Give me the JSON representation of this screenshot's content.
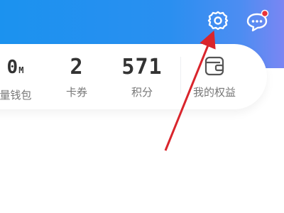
{
  "header": {
    "settings_icon": "gear-icon",
    "message_icon": "chat-bubble-icon",
    "background_color": "#1b92ef",
    "notification_dot_color": "#e8333a"
  },
  "stats": {
    "wallet": {
      "value": "0",
      "unit": "M",
      "label": "量钱包"
    },
    "coupons": {
      "value": "2",
      "label": "卡券"
    },
    "points": {
      "value": "571",
      "label": "积分"
    },
    "benefits": {
      "label": "我的权益",
      "icon": "wallet-icon"
    }
  },
  "annotation": {
    "arrow_color": "#d9252c",
    "arrow_target": "settings-button"
  }
}
